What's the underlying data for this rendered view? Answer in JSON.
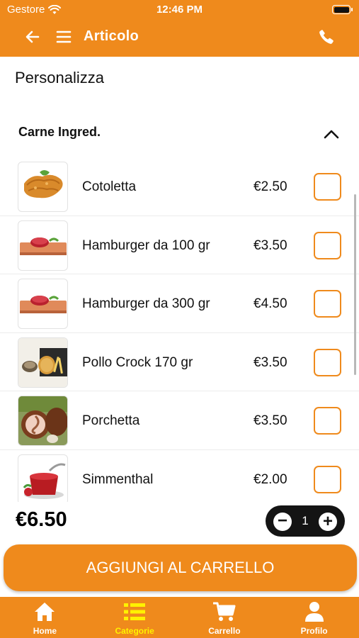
{
  "status_bar": {
    "carrier": "Gestore",
    "time": "12:46 PM"
  },
  "nav": {
    "title": "Articolo"
  },
  "section_title": "Personalizza",
  "group": {
    "title": "Carne Ingred."
  },
  "items": [
    {
      "name": "Cotoletta",
      "price": "€2.50",
      "checked": false
    },
    {
      "name": "Hamburger da 100 gr",
      "price": "€3.50",
      "checked": false
    },
    {
      "name": "Hamburger da 300 gr",
      "price": "€4.50",
      "checked": false
    },
    {
      "name": "Pollo Crock 170 gr",
      "price": "€3.50",
      "checked": false
    },
    {
      "name": "Porchetta",
      "price": "€3.50",
      "checked": false
    },
    {
      "name": "Simmenthal",
      "price": "€2.00",
      "checked": false
    }
  ],
  "footer": {
    "total": "€6.50",
    "quantity": "1",
    "add_button": "AGGIUNGI AL CARRELLO"
  },
  "tabs": [
    {
      "label": "Home",
      "icon": "home-icon",
      "active": false
    },
    {
      "label": "Categorie",
      "icon": "list-icon",
      "active": true
    },
    {
      "label": "Carrello",
      "icon": "cart-icon",
      "active": false
    },
    {
      "label": "Profilo",
      "icon": "person-icon",
      "active": false
    }
  ],
  "colors": {
    "accent": "#ef8a1c",
    "active_tab": "#fff200",
    "stepper_bg": "#141414"
  }
}
